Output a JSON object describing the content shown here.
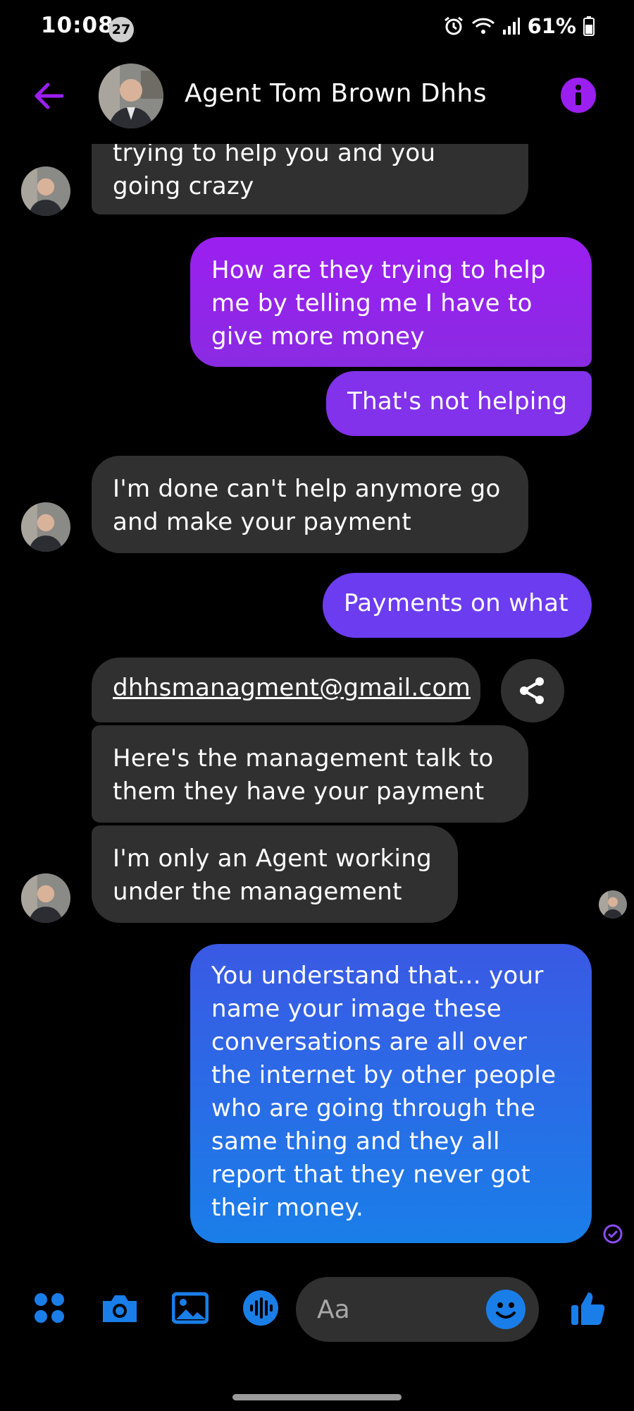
{
  "status_bar": {
    "time": "10:08",
    "notification_count": "27",
    "battery": "61%"
  },
  "header": {
    "contact_name": "Agent Tom Brown Dhhs"
  },
  "messages": [
    {
      "from": "them",
      "text": "trying to help you and you going crazy"
    },
    {
      "from": "me",
      "text": "How are they trying to help me by telling me I have to give more money"
    },
    {
      "from": "me",
      "text": "That's not helping"
    },
    {
      "from": "them",
      "text": "I'm done can't help anymore go and make your payment"
    },
    {
      "from": "me",
      "text": "Payments on what"
    },
    {
      "from": "them",
      "text": "dhhsmanagment@gmail.com"
    },
    {
      "from": "them",
      "text": "Here's the management talk to them they have your payment"
    },
    {
      "from": "them",
      "text": "I'm only an Agent working under the management"
    },
    {
      "from": "me",
      "text": "You understand that... your name your image these conversations are all over the internet by other people who are going through the same thing and they all report that they never got their money."
    }
  ],
  "composer": {
    "placeholder": "Aa"
  },
  "colors": {
    "accent": "#9b1ff0",
    "outgoing_purple": "#8a2be2",
    "outgoing_blue": "#1a7ee8",
    "incoming": "#303030"
  }
}
